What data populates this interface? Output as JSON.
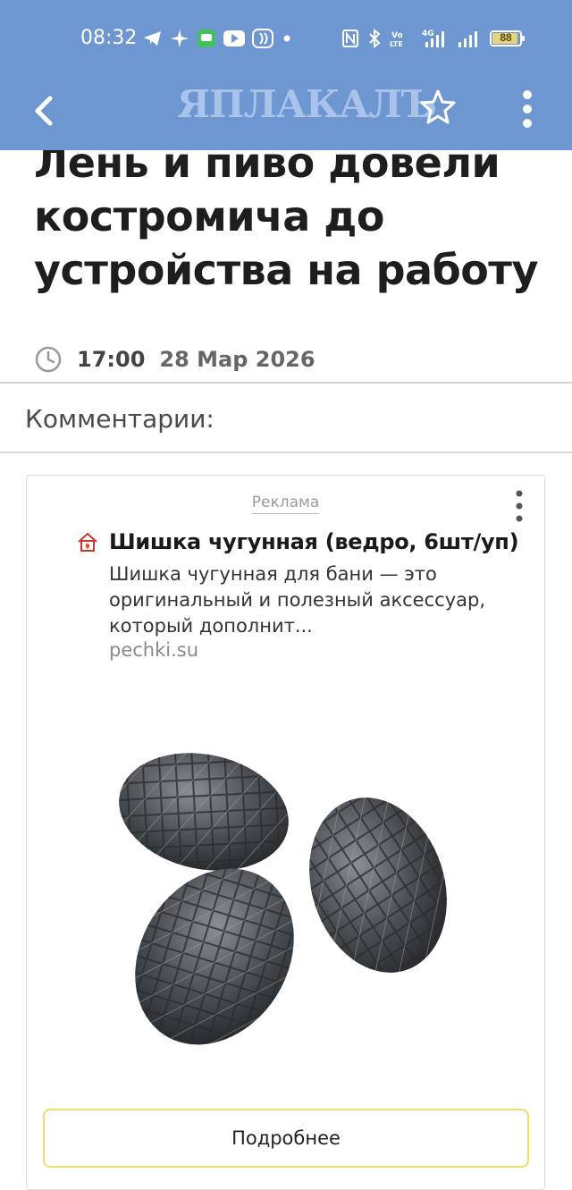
{
  "status_bar": {
    "time": "08:32",
    "battery": "88",
    "left_icons": [
      "telegram-icon",
      "sparkle-icon",
      "messages-icon",
      "youtube-icon",
      "wallet-icon",
      "dot-icon"
    ],
    "right_icons": [
      "nfc-icon",
      "bluetooth-icon",
      "volte-icon",
      "signal-4g-icon",
      "signal-icon",
      "battery-icon"
    ]
  },
  "app_bar": {
    "logo_text": "ЯПЛАКАЛЪ",
    "icons": [
      "back-arrow-icon",
      "star-icon",
      "more-vert-icon"
    ]
  },
  "article": {
    "title": "Лень и пиво довели костромича до устройства на работу",
    "time": "17:00",
    "date": "28 Мар 2026"
  },
  "comments": {
    "heading": "Комментарии:"
  },
  "ad": {
    "label": "Реклама",
    "headline": "Шишка чугунная (ведро, 6шт/уп)",
    "description": "Шишка чугунная для бани — это оригинальный и полезный аксессуар, который дополнит...",
    "domain": "pechki.su",
    "cta": "Подробнее"
  },
  "colors": {
    "app_bar": "#6e97d2",
    "logo": "#a9c3ea",
    "cta_border": "#f0dc6a"
  }
}
